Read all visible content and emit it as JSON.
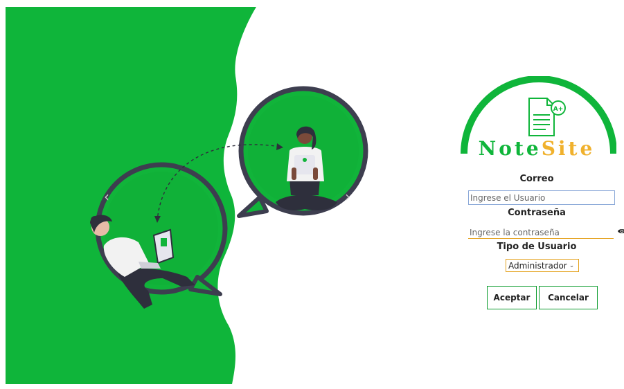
{
  "colors": {
    "brand_green": "#0fb53a",
    "outline_dark": "#3d3e4f",
    "accent_orange": "#f0b12d"
  },
  "hero": {
    "illustration": "two people chatting in speech bubbles"
  },
  "logo": {
    "part1": "Note",
    "part2": "Site",
    "badge": "A+"
  },
  "form": {
    "email_label": "Correo",
    "email_placeholder": "Ingrese el Usuario",
    "password_label": "Contraseña",
    "password_placeholder": "Ingrese la contraseña",
    "user_type_label": "Tipo de Usuario",
    "user_type_selected": "Administrador"
  },
  "buttons": {
    "accept": "Aceptar",
    "cancel": "Cancelar"
  }
}
